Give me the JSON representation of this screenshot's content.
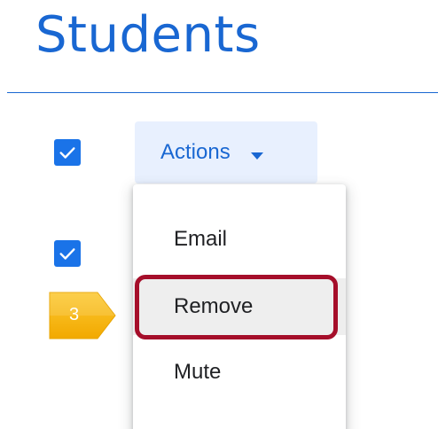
{
  "page": {
    "title": "Students"
  },
  "colors": {
    "accent": "#1967d2",
    "checkbox": "#1a73e8",
    "button_bg": "#e8f0fe",
    "highlight_border": "#a50e2a",
    "step_marker": "#f6b812"
  },
  "list": {
    "rows": [
      {
        "checked": true
      },
      {
        "checked": true,
        "trailing_text": ":"
      }
    ]
  },
  "toolbar": {
    "actions_label": "Actions",
    "actions_icon": "caret-down-icon"
  },
  "actions_menu": {
    "items": [
      {
        "label": "Email"
      },
      {
        "label": "Remove",
        "highlighted": true
      },
      {
        "label": "Mute"
      }
    ]
  },
  "tutorial": {
    "step_number": "3"
  }
}
